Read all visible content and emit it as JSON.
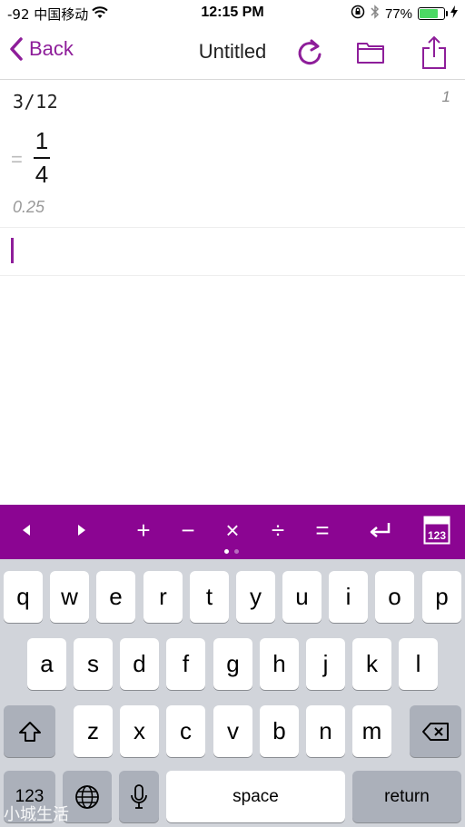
{
  "status_bar": {
    "carrier": "-92 中国移动",
    "time": "12:15 PM",
    "battery": "77%",
    "battery_level": 0.77
  },
  "nav": {
    "back_label": "Back",
    "title": "Untitled"
  },
  "document": {
    "expression": "3/12",
    "line_number": "1",
    "equals": "=",
    "numerator": "1",
    "denominator": "4",
    "decimal": "0.25"
  },
  "toolbar": {
    "plus": "+",
    "minus": "−",
    "times": "×",
    "divide": "÷",
    "equals": "=",
    "page_count": 2,
    "active_page": 1
  },
  "keyboard": {
    "row1": [
      "q",
      "w",
      "e",
      "r",
      "t",
      "y",
      "u",
      "i",
      "o",
      "p"
    ],
    "row2": [
      "a",
      "s",
      "d",
      "f",
      "g",
      "h",
      "j",
      "k",
      "l"
    ],
    "row3": [
      "z",
      "x",
      "c",
      "v",
      "b",
      "n",
      "m"
    ],
    "numbers_label": "123",
    "space_label": "space",
    "return_label": "return"
  },
  "watermark": "小城生活",
  "colors": {
    "accent": "#8e1e9a",
    "toolbar": "#8b0592"
  }
}
